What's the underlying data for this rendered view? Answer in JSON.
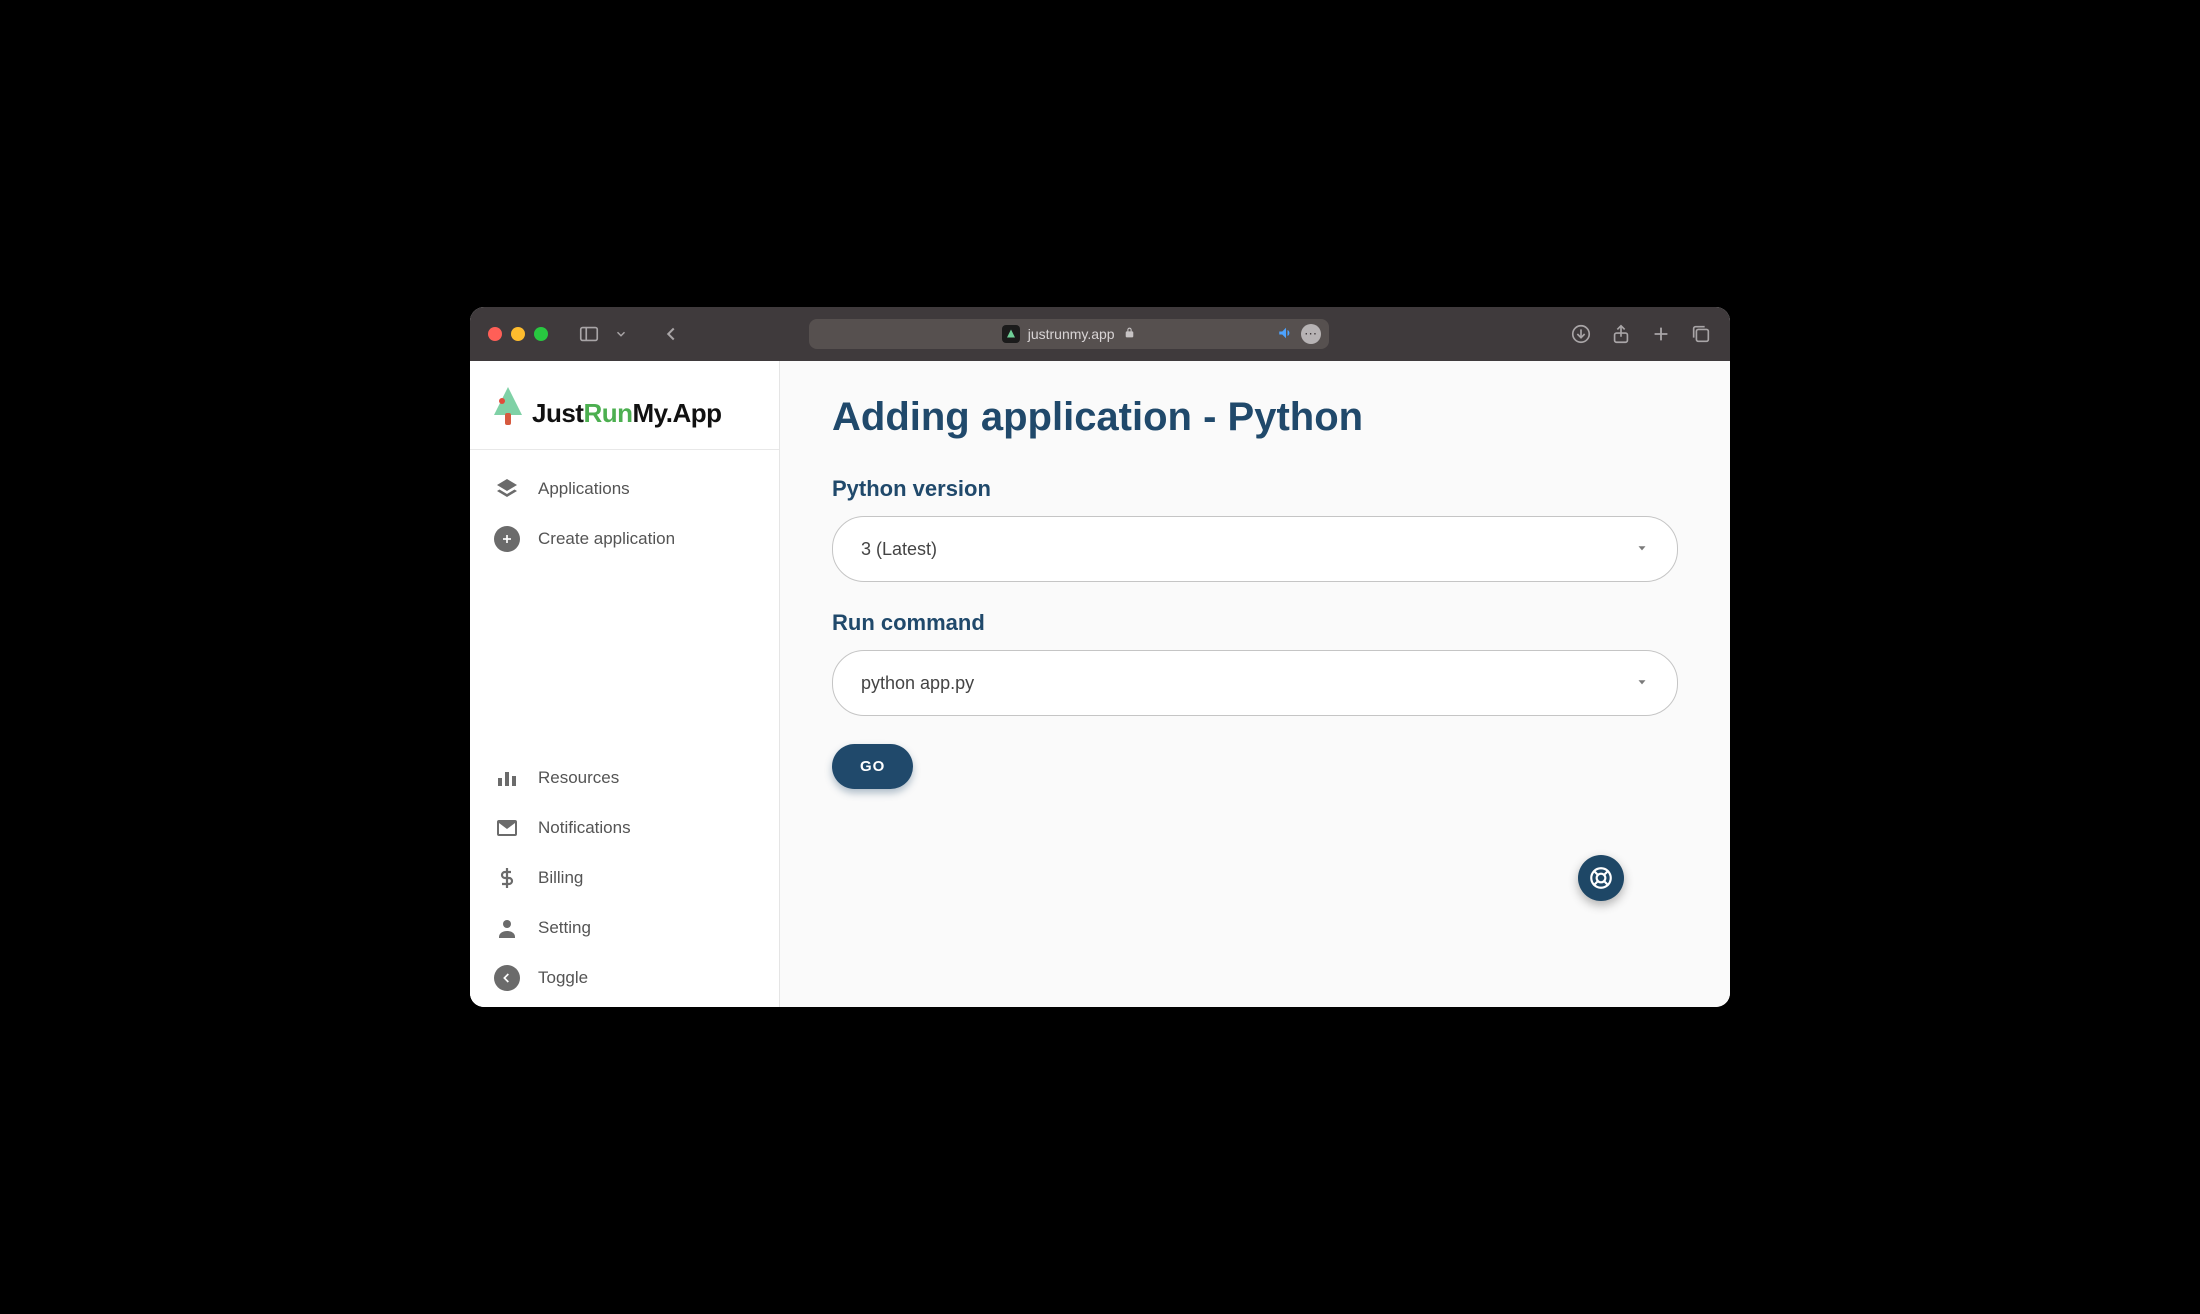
{
  "browser": {
    "url_display": "justrunmy.app"
  },
  "logo": {
    "part_just": "Just",
    "part_run": "Run",
    "part_my": "My",
    "part_app": ".App"
  },
  "sidebar": {
    "top": [
      {
        "label": "Applications"
      },
      {
        "label": "Create application"
      }
    ],
    "bottom": [
      {
        "label": "Resources"
      },
      {
        "label": "Notifications"
      },
      {
        "label": "Billing"
      },
      {
        "label": "Setting"
      },
      {
        "label": "Toggle"
      }
    ]
  },
  "page": {
    "title": "Adding application - Python",
    "version_label": "Python version",
    "version_value": "3 (Latest)",
    "command_label": "Run command",
    "command_value": "python app.py",
    "go_label": "GO"
  }
}
